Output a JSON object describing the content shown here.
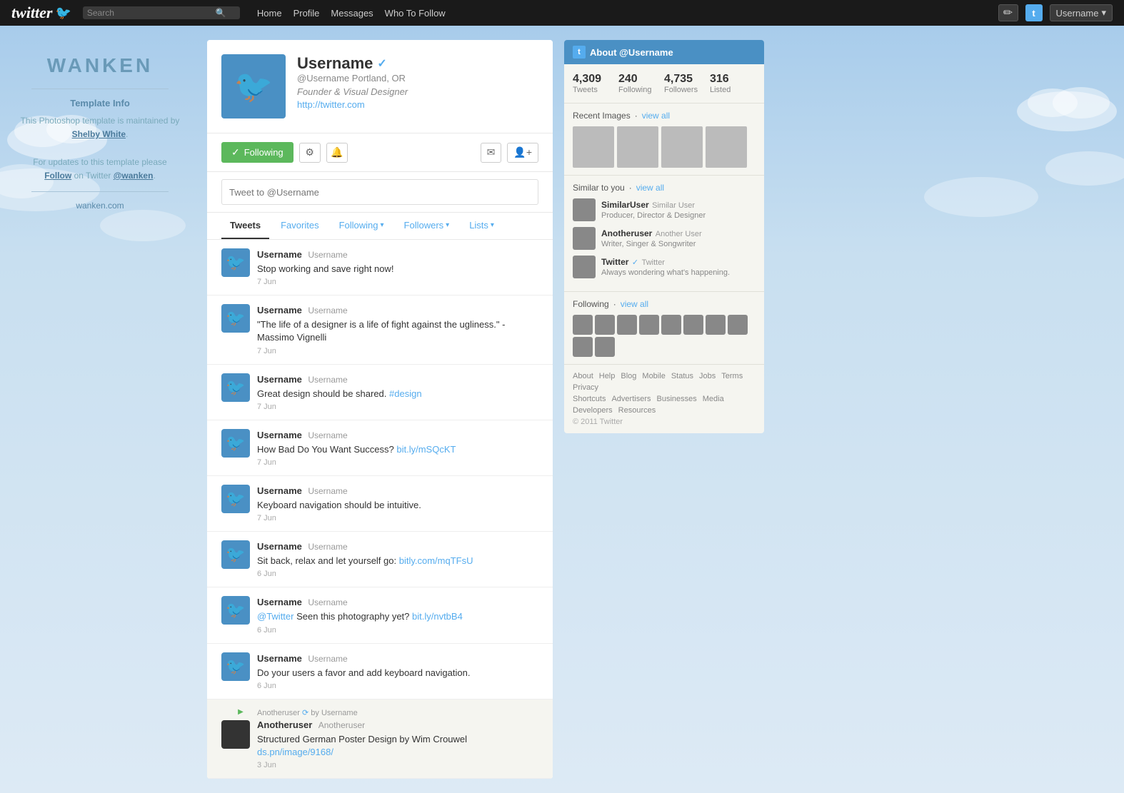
{
  "nav": {
    "logo_text": "twitter",
    "search_placeholder": "Search",
    "links": [
      "Home",
      "Profile",
      "Messages",
      "Who To Follow"
    ],
    "username_label": "Username",
    "dropdown_arrow": "▾"
  },
  "left_sidebar": {
    "logo": "WANKEN",
    "template_info_title": "Template Info",
    "template_info_line1": "This Photoshop template is maintained by",
    "author_link": "Shelby White",
    "template_info_line2": "For updates to this template please",
    "follow_text": "Follow",
    "on_twitter": "on Twitter",
    "twitter_handle": "@wanken",
    "website": "wanken.com"
  },
  "profile": {
    "name": "Username",
    "verified": "✓",
    "handle": "@Username",
    "location": "Portland, OR",
    "bio": "Founder & Visual Designer",
    "url": "http://twitter.com",
    "following_label": "Following",
    "tweet_placeholder": "Tweet to @Username"
  },
  "tabs": {
    "tweets": "Tweets",
    "favorites": "Favorites",
    "following": "Following",
    "followers": "Followers",
    "lists": "Lists"
  },
  "tweets": [
    {
      "username": "Username",
      "handle": "Username",
      "text": "Stop working and save right now!",
      "date": "7 Jun",
      "link": null,
      "link_text": null,
      "type": "normal"
    },
    {
      "username": "Username",
      "handle": "Username",
      "text": "\"The life of a designer is a life of fight against the ugliness.\" - Massimo Vignelli",
      "date": "7 Jun",
      "link": null,
      "link_text": null,
      "type": "normal"
    },
    {
      "username": "Username",
      "handle": "Username",
      "text": "Great design should be shared.",
      "date": "7 Jun",
      "link": "#design",
      "link_text": "#design",
      "type": "normal"
    },
    {
      "username": "Username",
      "handle": "Username",
      "text": "How Bad Do You Want Success?",
      "date": "7 Jun",
      "link": "bit.ly/mSQcKT",
      "link_text": "bit.ly/mSQcKT",
      "type": "normal"
    },
    {
      "username": "Username",
      "handle": "Username",
      "text": "Keyboard navigation should be intuitive.",
      "date": "7 Jun",
      "link": null,
      "link_text": null,
      "type": "normal"
    },
    {
      "username": "Username",
      "handle": "Username",
      "text": "Sit back, relax and let yourself go:",
      "date": "6 Jun",
      "link": "bitly.com/mqTFsU",
      "link_text": "bitly.com/mqTFsU",
      "type": "normal"
    },
    {
      "username": "Username",
      "handle": "Username",
      "text": "@Twitter Seen this photography yet?",
      "date": "6 Jun",
      "mention": "@Twitter",
      "link": "bit.ly/nvtbB4",
      "link_text": "bit.ly/nvtbB4",
      "type": "normal"
    },
    {
      "username": "Username",
      "handle": "Username",
      "text": "Do your users a favor and add keyboard navigation.",
      "date": "6 Jun",
      "link": null,
      "link_text": null,
      "type": "normal"
    },
    {
      "username": "Anotheruser",
      "handle": "Anotheruser",
      "retweeted_by": "by Username",
      "text": "Structured German Poster Design by Wim Crouwel",
      "date": "3 Jun",
      "link": "ds.pn/image/9168/",
      "link_text": "ds.pn/image/9168/",
      "type": "retweet"
    }
  ],
  "about": {
    "title": "About @Username",
    "stats": {
      "tweets": "4,309",
      "tweets_label": "Tweets",
      "following": "240",
      "following_label": "Following",
      "followers": "4,735",
      "followers_label": "Followers",
      "listed": "316",
      "listed_label": "Listed"
    },
    "recent_images_label": "Recent Images",
    "view_all": "view all",
    "similar_label": "Similar to you",
    "similar_users": [
      {
        "name": "SimilarUser",
        "handle": "Similar User",
        "desc": "Producer, Director & Designer",
        "verified": false
      },
      {
        "name": "Anotheruser",
        "handle": "Another User",
        "desc": "Writer, Singer & Songwriter",
        "verified": false
      },
      {
        "name": "Twitter",
        "handle": "Twitter",
        "desc": "Always wondering what's happening.",
        "verified": true
      }
    ],
    "following_label": "Following",
    "following_count": 10
  },
  "footer": {
    "links": [
      "About",
      "Help",
      "Blog",
      "Mobile",
      "Status",
      "Jobs",
      "Terms",
      "Privacy",
      "Shortcuts",
      "Advertisers",
      "Businesses",
      "Media",
      "Developers",
      "Resources"
    ],
    "copyright": "© 2011 Twitter"
  }
}
